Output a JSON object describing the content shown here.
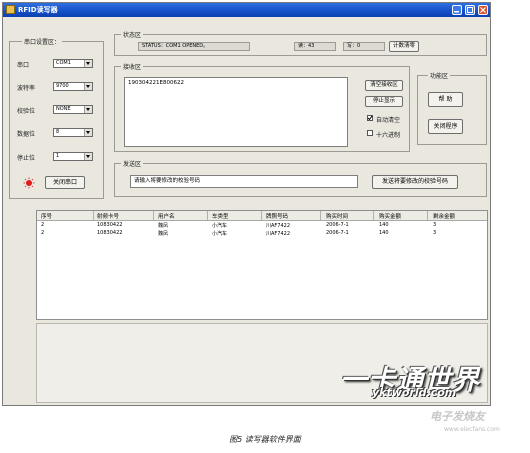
{
  "window": {
    "title": "RFID读写器",
    "colors": {
      "titlebar": "#1450c8",
      "body": "#e9e7de",
      "close": "#d8542e"
    }
  },
  "serial_group": {
    "title": "串口设置区：",
    "fields": [
      {
        "label": "串口",
        "value": "COM1"
      },
      {
        "label": "波特率",
        "value": "9700"
      },
      {
        "label": "校验位",
        "value": "NONE"
      },
      {
        "label": "数据位",
        "value": "8"
      },
      {
        "label": "停止位",
        "value": "1"
      }
    ],
    "close_button": "关闭串口"
  },
  "status_group": {
    "title": "状态区",
    "status_text": "STATUS：COM1 OPENED。",
    "read_count": "读：43",
    "write_count": "写：0",
    "clear_count": "计数清零"
  },
  "receive_group": {
    "title": "接收区",
    "content": "190304221E800622",
    "clear_button": "清空接收区",
    "stop_button": "停止显示",
    "auto_clear_label": "自动清空",
    "auto_clear_checked": true,
    "hex_label": "十六进制",
    "hex_checked": false
  },
  "function_group": {
    "title": "功能区",
    "help_button": "帮 助",
    "close_program_button": "关闭程序"
  },
  "send_group": {
    "title": "发送区",
    "input_value": "请输入将要修改的校验号码",
    "send_button": "发送将要修改的校验号码"
  },
  "table": {
    "columns": [
      "序号",
      "射频卡号",
      "用户名",
      "车类型",
      "牌照号码",
      "购买时间",
      "购买金额",
      "剩余金额"
    ],
    "rows": [
      [
        "2",
        "10830422",
        "魏凤",
        "小汽车",
        "川AF7422",
        "2006-7-1",
        "140",
        "3"
      ],
      [
        "2",
        "10830422",
        "魏凤",
        "小汽车",
        "川AF7422",
        "2006-7-1",
        "140",
        "3"
      ]
    ]
  },
  "watermark": {
    "line1": "一卡通世界",
    "line2": "yktworld.com",
    "line3": "电子发烧友",
    "line4": "www.elecfans.com"
  },
  "caption": "图5  读写器软件界面"
}
